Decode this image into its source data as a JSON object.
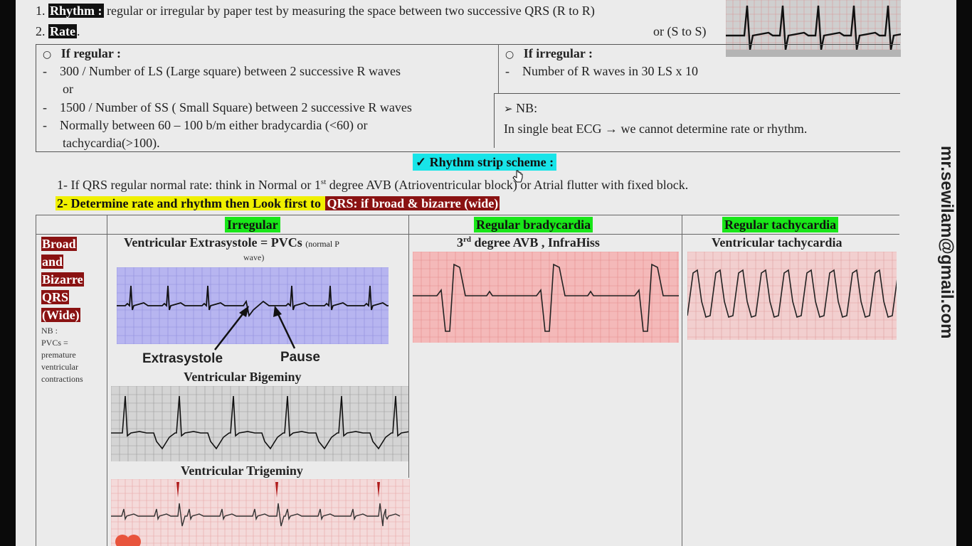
{
  "rhythm_line": {
    "number": "1.",
    "label": "Rhythm :",
    "text": " regular or irregular by paper test by measuring the space between two successive QRS (R to R)"
  },
  "rate_line": {
    "number": "2.",
    "label": "Rate",
    "suffix": ".",
    "right_text": "or (S to S)"
  },
  "regular_box": {
    "heading": "If regular :",
    "lines": [
      "300 / Number of LS (Large square) between 2 successive R waves",
      "or",
      "1500 / Number of SS ( Small Square) between 2 successive R waves",
      "Normally between 60 – 100 b/m either bradycardia (<60) or",
      "tachycardia(>100)."
    ]
  },
  "irregular_box": {
    "heading": "If irregular :",
    "line": "Number of R waves in 30 LS x 10"
  },
  "nb_box": {
    "heading": "NB:",
    "line": "In single beat ECG → we cannot determine rate or rhythm."
  },
  "scheme_title": "✓  Rhythm strip scheme :",
  "point1": {
    "prefix": "1- If QRS regular normal rate: think in Normal or 1",
    "sup": "st",
    "suffix": " degree AVB (Atrioventricular block) or Atrial flutter with fixed block."
  },
  "point2": {
    "yellow": "2- Determine rate and rhythm then Look first to ",
    "red": "QRS: if broad & bizarre (wide)"
  },
  "table": {
    "col_irregular": "Irregular",
    "col_brady": "Regular bradycardia",
    "col_tachy": "Regular tachycardia",
    "row_label": [
      "Broad",
      "and",
      "Bizarre",
      "QRS",
      "(Wide)"
    ],
    "nb_note": [
      "NB :",
      "PVCs =",
      "premature",
      "ventricular",
      "contractions"
    ],
    "pvc_title": "Ventricular Extrasystole = PVCs",
    "pvc_small": "(normal P",
    "pvc_small2": "wave)",
    "extrasystole_label": "Extrasystole",
    "pause_label": "Pause",
    "bigeminy_title": "Ventricular Bigeminy",
    "trigeminy_title": "Ventricular Trigeminy",
    "avb_prefix": "3",
    "avb_sup": "rd",
    "avb_suffix": " degree AVB , InfraHiss",
    "vt_title": "Ventricular tachycardia"
  },
  "email": "mr.sewilam@gmail.com",
  "colors": {
    "page": "#ebebeb",
    "green_header": "#19e619",
    "cyan": "#18e4e8",
    "yellow": "#f0f000",
    "dark_red": "#8a1212",
    "purple_ecg": "#b7b5f0",
    "pink_ecg": "#f4b9b9",
    "gray_ecg": "#d4d4d4"
  }
}
